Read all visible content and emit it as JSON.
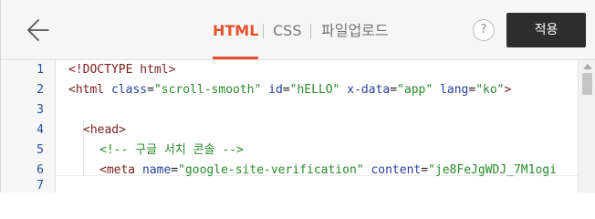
{
  "header": {
    "back_icon": "back-arrow-icon",
    "tabs": [
      {
        "label": "HTML",
        "active": true
      },
      {
        "label": "CSS",
        "active": false
      },
      {
        "label": "파일업로드",
        "active": false
      }
    ],
    "help_label": "?",
    "apply_label": "적용"
  },
  "colors": {
    "accent": "#e8512d",
    "apply_button": "#2d2d2d",
    "tag": "#7a1f1f",
    "attr_name": "#2b3f9a",
    "attr_value": "#2a8a2a",
    "line_number": "#2a4f9e"
  },
  "editor": {
    "lines": [
      {
        "n": "1",
        "p": [
          "<!DOCTYPE html>"
        ]
      },
      {
        "n": "2",
        "p": [
          "<html",
          " ",
          "class",
          "=",
          "\"scroll-smooth\"",
          " ",
          "id",
          "=",
          "\"hELLO\"",
          " ",
          "x-data",
          "=",
          "\"app\"",
          " ",
          "lang",
          "=",
          "\"ko\"",
          ">"
        ]
      },
      {
        "n": "3",
        "p": [
          ""
        ]
      },
      {
        "n": "4",
        "p": [
          "<head>"
        ]
      },
      {
        "n": "5",
        "p": [
          "<!-- 구글 서치 콘솔 -->"
        ]
      },
      {
        "n": "6",
        "p": [
          "<meta",
          " ",
          "name",
          "=",
          "\"google-site-verification\"",
          " ",
          "content",
          "=",
          "\"je8FeJgWDJ_7M1ogi"
        ]
      },
      {
        "n": "7",
        "p": [
          ""
        ]
      }
    ]
  }
}
